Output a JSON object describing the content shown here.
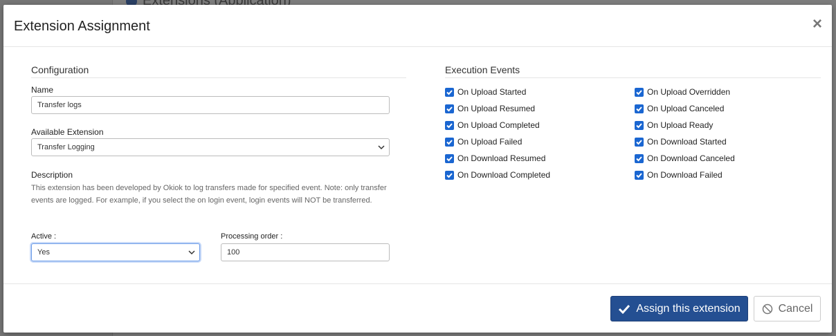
{
  "background": {
    "header_text": "Extensions (Application)"
  },
  "modal": {
    "title": "Extension Assignment",
    "close_icon": "×"
  },
  "configuration": {
    "section_title": "Configuration",
    "name_label": "Name",
    "name_value": "Transfer logs",
    "extension_label": "Available Extension",
    "extension_value": "Transfer Logging",
    "description_label": "Description",
    "description_text": "This extension has been developed by Okiok to log transfers made for specified event. Note: only transfer events are logged. For example, if you select the on login event, login events will NOT be transferred.",
    "active_label": "Active :",
    "active_value": "Yes",
    "processing_order_label": "Processing order :",
    "processing_order_value": "100"
  },
  "events": {
    "section_title": "Execution Events",
    "left": [
      {
        "label": "On Upload Started",
        "checked": true
      },
      {
        "label": "On Upload Resumed",
        "checked": true
      },
      {
        "label": "On Upload Completed",
        "checked": true
      },
      {
        "label": "On Upload Failed",
        "checked": true
      },
      {
        "label": "On Download Resumed",
        "checked": true
      },
      {
        "label": "On Download Completed",
        "checked": true
      }
    ],
    "right": [
      {
        "label": "On Upload Overridden",
        "checked": true
      },
      {
        "label": "On Upload Canceled",
        "checked": true
      },
      {
        "label": "On Upload Ready",
        "checked": true
      },
      {
        "label": "On Download Started",
        "checked": true
      },
      {
        "label": "On Download Canceled",
        "checked": true
      },
      {
        "label": "On Download Failed",
        "checked": true
      }
    ]
  },
  "footer": {
    "assign_label": "Assign this extension",
    "cancel_label": "Cancel"
  },
  "colors": {
    "primary": "#244f92",
    "checkbox": "#1a66d1"
  }
}
